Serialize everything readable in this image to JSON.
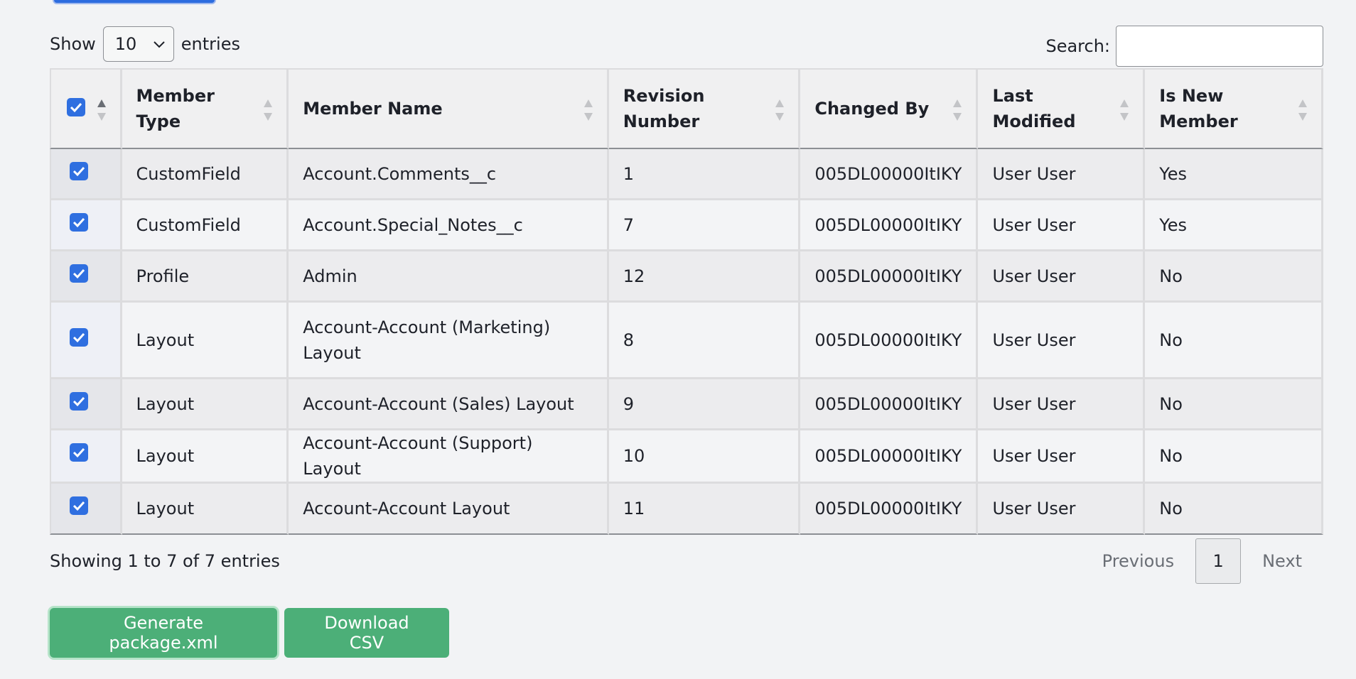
{
  "length_control": {
    "show_label": "Show",
    "selected": "10",
    "entries_label": "entries"
  },
  "search": {
    "label": "Search:",
    "value": ""
  },
  "table": {
    "headers": {
      "member_type": "Member Type",
      "member_name": "Member Name",
      "revision_number": "Revision Number",
      "changed_by": "Changed By",
      "last_modified": "Last Modified",
      "is_new_member": "Is New Member"
    },
    "rows": [
      {
        "member_type": "CustomField",
        "member_name": "Account.Comments__c",
        "revision_number": "1",
        "changed_by": "005DL00000ItIKY",
        "last_modified": "User User",
        "is_new_member": "Yes"
      },
      {
        "member_type": "CustomField",
        "member_name": "Account.Special_Notes__c",
        "revision_number": "7",
        "changed_by": "005DL00000ItIKY",
        "last_modified": "User User",
        "is_new_member": "Yes"
      },
      {
        "member_type": "Profile",
        "member_name": "Admin",
        "revision_number": "12",
        "changed_by": "005DL00000ItIKY",
        "last_modified": "User User",
        "is_new_member": "No"
      },
      {
        "member_type": "Layout",
        "member_name": "Account-Account (Marketing) Layout",
        "revision_number": "8",
        "changed_by": "005DL00000ItIKY",
        "last_modified": "User User",
        "is_new_member": "No"
      },
      {
        "member_type": "Layout",
        "member_name": "Account-Account (Sales) Layout",
        "revision_number": "9",
        "changed_by": "005DL00000ItIKY",
        "last_modified": "User User",
        "is_new_member": "No"
      },
      {
        "member_type": "Layout",
        "member_name": "Account-Account (Support) Layout",
        "revision_number": "10",
        "changed_by": "005DL00000ItIKY",
        "last_modified": "User User",
        "is_new_member": "No"
      },
      {
        "member_type": "Layout",
        "member_name": "Account-Account Layout",
        "revision_number": "11",
        "changed_by": "005DL00000ItIKY",
        "last_modified": "User User",
        "is_new_member": "No"
      }
    ]
  },
  "info": "Showing 1 to 7 of 7 entries",
  "pagination": {
    "previous": "Previous",
    "current": "1",
    "next": "Next"
  },
  "buttons": {
    "generate": "Generate package.xml",
    "download_csv": "Download CSV"
  },
  "colors": {
    "accent_blue": "#2f6fe0",
    "button_green": "#4caf78"
  }
}
